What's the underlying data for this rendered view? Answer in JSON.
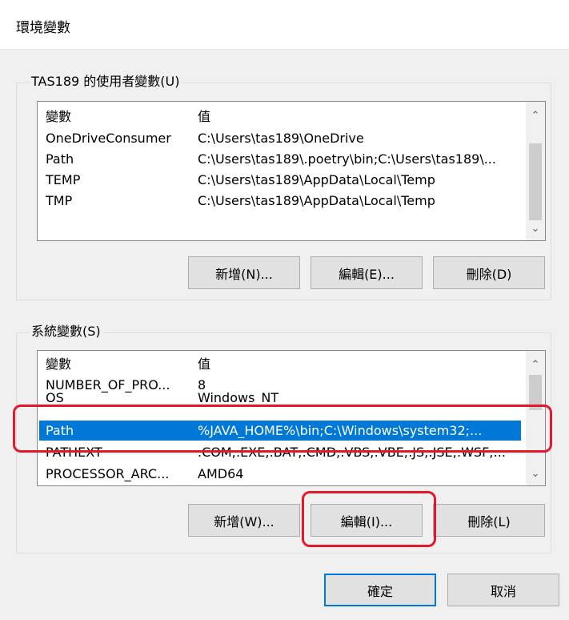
{
  "window": {
    "title": "環境變數"
  },
  "user_vars": {
    "group_label": "TAS189 的使用者變數(U)",
    "headers": [
      "變數",
      "值"
    ],
    "rows": [
      {
        "name": "OneDriveConsumer",
        "value": "C:\\Users\\tas189\\OneDrive"
      },
      {
        "name": "Path",
        "value": "C:\\Users\\tas189\\.poetry\\bin;C:\\Users\\tas189\\..."
      },
      {
        "name": "TEMP",
        "value": "C:\\Users\\tas189\\AppData\\Local\\Temp"
      },
      {
        "name": "TMP",
        "value": "C:\\Users\\tas189\\AppData\\Local\\Temp"
      }
    ],
    "buttons": {
      "new": "新增(N)...",
      "edit": "編輯(E)...",
      "delete": "刪除(D)"
    }
  },
  "system_vars": {
    "group_label": "系統變數(S)",
    "headers": [
      "變數",
      "值"
    ],
    "rows": [
      {
        "name": "NUMBER_OF_PRO...",
        "value": "8"
      },
      {
        "name": "OS",
        "value": "Windows_NT"
      },
      {
        "name": "Path",
        "value": "%JAVA_HOME%\\bin;C:\\Windows\\system32;..."
      },
      {
        "name": "PATHEXT",
        "value": ".COM;.EXE;.BAT;.CMD;.VBS;.VBE;.JS;.JSE;.WSF;..."
      },
      {
        "name": "PROCESSOR_ARC...",
        "value": "AMD64"
      }
    ],
    "selected_row": "Path",
    "buttons": {
      "new": "新增(W)...",
      "edit": "編輯(I)...",
      "delete": "刪除(L)"
    }
  },
  "dialog_buttons": {
    "ok": "確定",
    "cancel": "取消"
  },
  "icons": {
    "scroll_up": "chevron-up-icon",
    "scroll_down": "chevron-down-icon"
  },
  "colors": {
    "selection": "#0078d7",
    "highlight_annotation": "#e3182d",
    "default_button_border": "#0078d7"
  }
}
